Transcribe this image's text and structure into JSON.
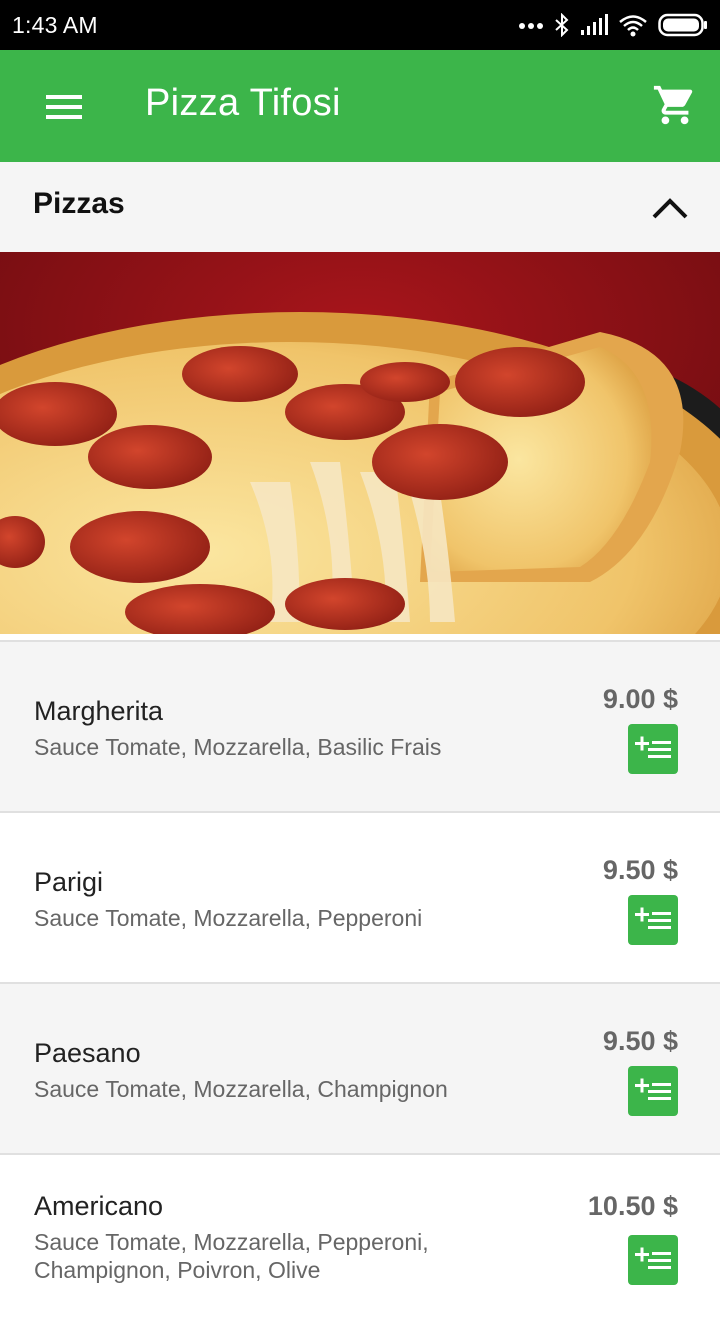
{
  "status_bar": {
    "time": "1:43 AM",
    "icons": [
      "more-dots-icon",
      "bluetooth-icon",
      "signal-icon",
      "wifi-icon",
      "battery-icon"
    ]
  },
  "app_bar": {
    "title": "Pizza Tifosi",
    "menu_icon": "hamburger-menu-icon",
    "cart_icon": "shopping-cart-icon",
    "color": "#3cb54a"
  },
  "section": {
    "title": "Pizzas",
    "toggle_icon": "chevron-up-icon"
  },
  "hero": {
    "image": "pepperoni-pizza-photo"
  },
  "items": [
    {
      "name": "Margherita",
      "description": "Sauce Tomate, Mozzarella, Basilic Frais",
      "price": "9.00 $"
    },
    {
      "name": "Parigi",
      "description": "Sauce Tomate, Mozzarella, Pepperoni",
      "price": "9.50 $"
    },
    {
      "name": "Paesano",
      "description": "Sauce Tomate, Mozzarella, Champignon",
      "price": "9.50 $"
    },
    {
      "name": "Americano",
      "description": "Sauce Tomate, Mozzarella, Pepperoni, Champignon, Poivron, Olive",
      "price": "10.50 $"
    }
  ],
  "add_button_icon": "add-to-list-icon"
}
